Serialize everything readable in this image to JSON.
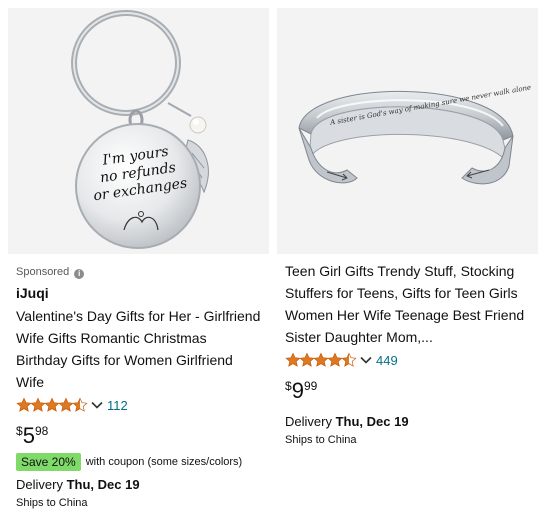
{
  "products": [
    {
      "sponsored_label": "Sponsored",
      "brand": "iJuqi",
      "title": "Valentine's Day Gifts for Her - Girlfriend Wife Gifts Romantic Christmas Birthday Gifts for Women Girlfriend Wife",
      "image_text": [
        "I'm yours",
        "no refunds",
        "or exchanges"
      ],
      "rating": 4.5,
      "rating_count": "112",
      "price_symbol": "$",
      "price_whole": "5",
      "price_fraction": "98",
      "coupon_badge": "Save 20%",
      "coupon_text": "with coupon (some sizes/colors)",
      "delivery_prefix": "Delivery ",
      "delivery_date": "Thu, Dec 19",
      "ships_from": "Ships to China"
    },
    {
      "title": "Teen Girl Gifts Trendy Stuff, Stocking Stuffers for Teens, Gifts for Teen Girls Women Her Wife Teenage Best Friend Sister Daughter Mom,...",
      "image_text": "A sister is God's way of making sure we never walk alone",
      "rating": 4.5,
      "rating_count": "449",
      "price_symbol": "$",
      "price_whole": "9",
      "price_fraction": "99",
      "delivery_prefix": "Delivery ",
      "delivery_date": "Thu, Dec 19",
      "ships_from": "Ships to China"
    }
  ],
  "colors": {
    "link": "#007185",
    "star": "#de7921",
    "coupon_badge": "#7fda69",
    "image_bg": "#f3f3f3"
  }
}
